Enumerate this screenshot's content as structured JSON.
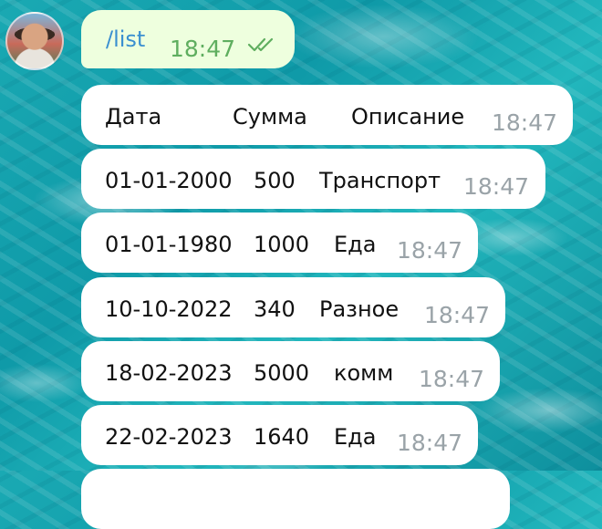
{
  "sent_message": {
    "text": "/list",
    "time": "18:47",
    "status_icon": "double-check-icon",
    "bubble_color": "#eeffde"
  },
  "rows": [
    {
      "date": "Дата",
      "amount": "Сумма",
      "desc": "Описание",
      "time": "18:47"
    },
    {
      "date": "01-01-2000",
      "amount": "500",
      "desc": "Транспорт",
      "time": "18:47"
    },
    {
      "date": "01-01-1980",
      "amount": "1000",
      "desc": "Еда",
      "time": "18:47"
    },
    {
      "date": "10-10-2022",
      "amount": "340",
      "desc": "Разное",
      "time": "18:47"
    },
    {
      "date": "18-02-2023",
      "amount": "5000",
      "desc": "комм",
      "time": "18:47"
    },
    {
      "date": "22-02-2023",
      "amount": "1640",
      "desc": "Еда",
      "time": "18:47"
    }
  ],
  "colors": {
    "link": "#3a8fd0",
    "sent_time": "#5fae5f",
    "received_time": "#9aa3a8"
  }
}
